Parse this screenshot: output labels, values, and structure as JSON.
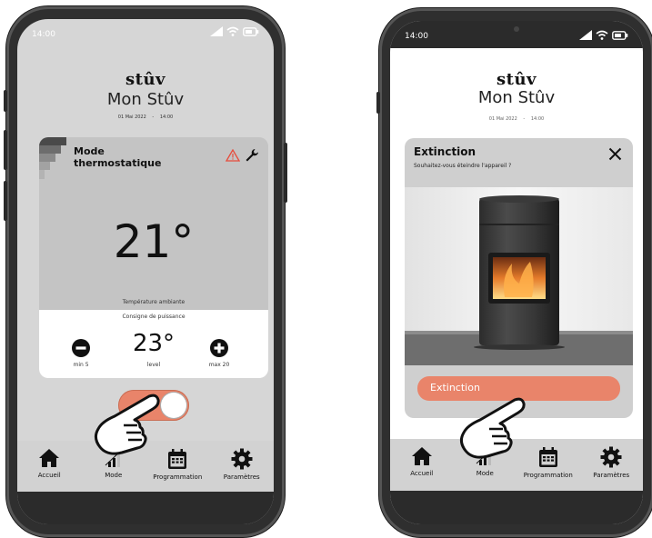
{
  "status": {
    "time": "14:00"
  },
  "brand": {
    "logo": "stûv",
    "title": "Mon Stûv",
    "date": "01 Mai 2022",
    "date_sep": "-",
    "time": "14:00"
  },
  "left_screen": {
    "mode_line1": "Mode",
    "mode_line2": "thermostatique",
    "temperature": "21°",
    "temperature_label": "Température ambiante",
    "power_label": "Consigne de puissance",
    "level_value": "23°",
    "min_label": "min 5",
    "level_label": "level",
    "max_label": "max 20",
    "colors": {
      "toggle": "#e9846a",
      "warning": "#e74c3c"
    }
  },
  "right_screen": {
    "dialog_title": "Extinction",
    "dialog_question": "Souhaitez-vous éteindre l'appareil ?",
    "action_button": "Extinction",
    "colors": {
      "action": "#e9846a"
    }
  },
  "tabs": [
    {
      "label": "Accueil",
      "icon": "home-icon"
    },
    {
      "label": "Mode",
      "icon": "signal-bars-icon"
    },
    {
      "label": "Programmation",
      "icon": "calendar-icon"
    },
    {
      "label": "Paramètres",
      "icon": "gear-icon"
    }
  ]
}
